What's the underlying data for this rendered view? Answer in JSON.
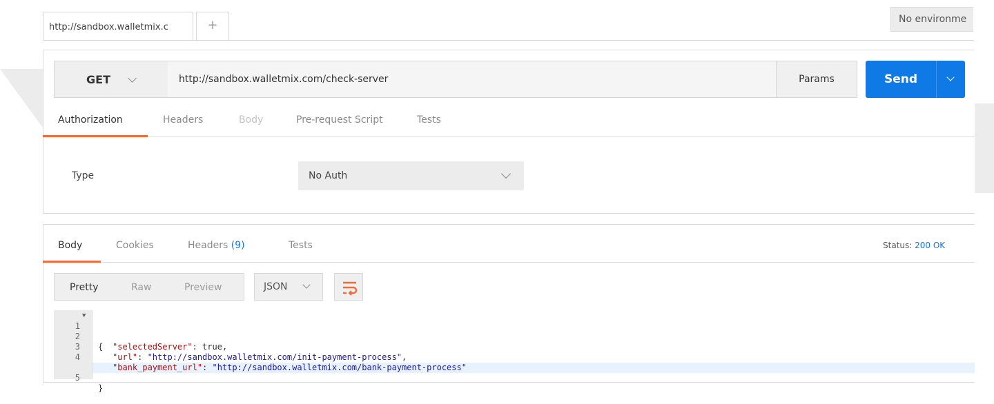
{
  "tabs": {
    "active_tab_title": "http://sandbox.walletmix.c",
    "new_tab_symbol": "+"
  },
  "environment": {
    "label": "No environme"
  },
  "request": {
    "method": "GET",
    "url": "http://sandbox.walletmix.com/check-server",
    "params_label": "Params",
    "send_label": "Send",
    "subtabs": [
      "Authorization",
      "Headers",
      "Body",
      "Pre-request Script",
      "Tests"
    ],
    "active_subtab": "Authorization",
    "auth": {
      "type_label": "Type",
      "type_value": "No Auth"
    }
  },
  "response": {
    "tabs": [
      "Body",
      "Cookies",
      "Headers",
      "Tests"
    ],
    "headers_count": "(9)",
    "active_tab": "Body",
    "status_label": "Status:",
    "status_value": "200 OK",
    "view_modes": [
      "Pretty",
      "Raw",
      "Preview"
    ],
    "active_view_mode": "Pretty",
    "format": "JSON",
    "code": {
      "line_numbers": [
        "1",
        "2",
        "3",
        "4",
        "5"
      ],
      "open_brace": "{",
      "close_brace": "}",
      "k1": "\"selectedServer\"",
      "v1": "true",
      "k2": "\"url\"",
      "v2": "\"http://sandbox.walletmix.com/init-payment-process\"",
      "k3": "\"bank_payment_url\"",
      "v3": "\"http://sandbox.walletmix.com/bank-payment-process\"",
      "sep": ": ",
      "comma": ","
    }
  },
  "colors": {
    "accent": "#f26b3a",
    "send_button": "#0f7ae5",
    "status_ok": "#0f7ae5"
  }
}
